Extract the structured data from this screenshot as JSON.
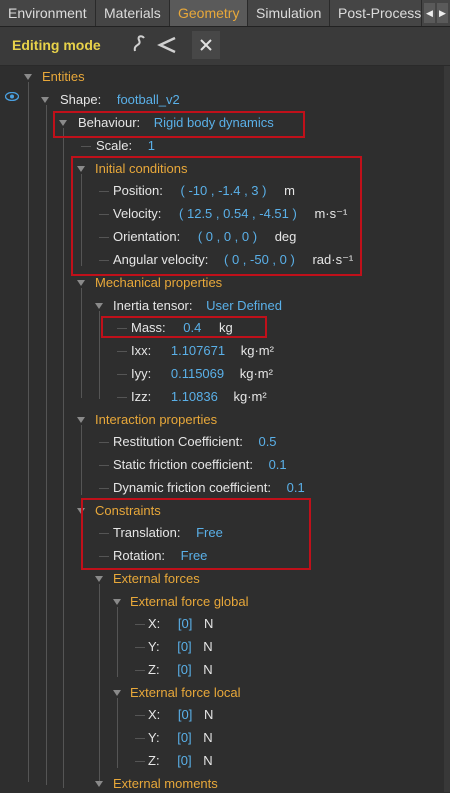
{
  "tabs": [
    "Environment",
    "Materials",
    "Geometry",
    "Simulation",
    "Post-Process"
  ],
  "toolbar": {
    "mode_label": "Editing mode"
  },
  "tree": {
    "entities": "Entities",
    "shape_label": "Shape:",
    "shape_value": "football_v2",
    "behaviour_label": "Behaviour:",
    "behaviour_value": "Rigid body dynamics",
    "scale_label": "Scale:",
    "scale_value": "1",
    "initial_conditions": {
      "title": "Initial conditions",
      "position": {
        "label": "Position:",
        "value": "( -10 , -1.4 , 3 )",
        "unit": "m"
      },
      "velocity": {
        "label": "Velocity:",
        "value": "( 12.5 , 0.54 , -4.51 )",
        "unit": "m·s⁻¹"
      },
      "orientation": {
        "label": "Orientation:",
        "value": "( 0 , 0 , 0 )",
        "unit": "deg"
      },
      "angular_velocity": {
        "label": "Angular velocity:",
        "value": "( 0 , -50 , 0 )",
        "unit": "rad·s⁻¹"
      }
    },
    "mechanical": {
      "title": "Mechanical properties",
      "inertia_label": "Inertia tensor:",
      "inertia_value": "User Defined",
      "mass": {
        "label": "Mass:",
        "value": "0.4",
        "unit": "kg"
      },
      "ixx": {
        "label": "Ixx:",
        "value": "1.107671",
        "unit": "kg·m²"
      },
      "iyy": {
        "label": "Iyy:",
        "value": "0.115069",
        "unit": "kg·m²"
      },
      "izz": {
        "label": "Izz:",
        "value": "1.10836",
        "unit": "kg·m²"
      }
    },
    "interaction": {
      "title": "Interaction properties",
      "restitution": {
        "label": "Restitution Coefficient:",
        "value": "0.5"
      },
      "static_friction": {
        "label": "Static friction coefficient:",
        "value": "0.1"
      },
      "dynamic_friction": {
        "label": "Dynamic friction coefficient:",
        "value": "0.1"
      }
    },
    "constraints": {
      "title": "Constraints",
      "translation": {
        "label": "Translation:",
        "value": "Free"
      },
      "rotation": {
        "label": "Rotation:",
        "value": "Free"
      }
    },
    "external_forces": {
      "title": "External forces",
      "global": {
        "title": "External force global",
        "x": {
          "label": "X:",
          "value": "[0]",
          "unit": "N"
        },
        "y": {
          "label": "Y:",
          "value": "[0]",
          "unit": "N"
        },
        "z": {
          "label": "Z:",
          "value": "[0]",
          "unit": "N"
        }
      },
      "local": {
        "title": "External force local",
        "x": {
          "label": "X:",
          "value": "[0]",
          "unit": "N"
        },
        "y": {
          "label": "Y:",
          "value": "[0]",
          "unit": "N"
        },
        "z": {
          "label": "Z:",
          "value": "[0]",
          "unit": "N"
        }
      }
    },
    "external_moments": "External moments"
  },
  "colors": {
    "section": "#e8a83a",
    "value": "#5ab0e8",
    "highlight": "#c0101a",
    "active_tab": "#e8a83a",
    "mode_label": "#e8d24a"
  }
}
